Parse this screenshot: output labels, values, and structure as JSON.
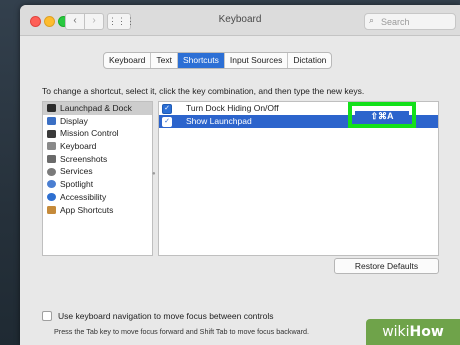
{
  "window": {
    "title": "Keyboard"
  },
  "search": {
    "placeholder": "Search"
  },
  "tabs": [
    {
      "label": "Keyboard",
      "active": false
    },
    {
      "label": "Text",
      "active": false
    },
    {
      "label": "Shortcuts",
      "active": true
    },
    {
      "label": "Input Sources",
      "active": false
    },
    {
      "label": "Dictation",
      "active": false
    }
  ],
  "instructions": "To change a shortcut, select it, click the key combination, and then type the new keys.",
  "categories": [
    {
      "label": "Launchpad & Dock",
      "icon": "launchpad-dock-icon",
      "color": "#2b2b2b",
      "selected": true
    },
    {
      "label": "Display",
      "icon": "display-icon",
      "color": "#3b6fc4",
      "selected": false
    },
    {
      "label": "Mission Control",
      "icon": "mission-control-icon",
      "color": "#3a3a3a",
      "selected": false
    },
    {
      "label": "Keyboard",
      "icon": "keyboard-icon",
      "color": "#8a8a8a",
      "selected": false
    },
    {
      "label": "Screenshots",
      "icon": "screenshots-icon",
      "color": "#6a6a6a",
      "selected": false
    },
    {
      "label": "Services",
      "icon": "services-gear-icon",
      "color": "#7a7a7a",
      "selected": false
    },
    {
      "label": "Spotlight",
      "icon": "spotlight-icon",
      "color": "#4a7ed1",
      "selected": false
    },
    {
      "label": "Accessibility",
      "icon": "accessibility-icon",
      "color": "#2e6fd0",
      "selected": false
    },
    {
      "label": "App Shortcuts",
      "icon": "app-shortcuts-icon",
      "color": "#c58a3a",
      "selected": false
    }
  ],
  "shortcuts": [
    {
      "label": "Turn Dock Hiding On/Off",
      "enabled": true,
      "key": "",
      "selected": false
    },
    {
      "label": "Show Launchpad",
      "enabled": true,
      "key": "⇧⌘A",
      "selected": true
    }
  ],
  "restore_defaults": "Restore Defaults",
  "keyboard_navigation": {
    "label": "Use keyboard navigation to move focus between controls",
    "checked": false,
    "note": "Press the Tab key to move focus forward and Shift Tab to move focus backward."
  },
  "watermark": {
    "prefix": "wiki",
    "suffix": "How"
  },
  "colors": {
    "accent": "#2c6fd5",
    "selection": "#2c64cc",
    "highlight_box": "#13e01a"
  }
}
